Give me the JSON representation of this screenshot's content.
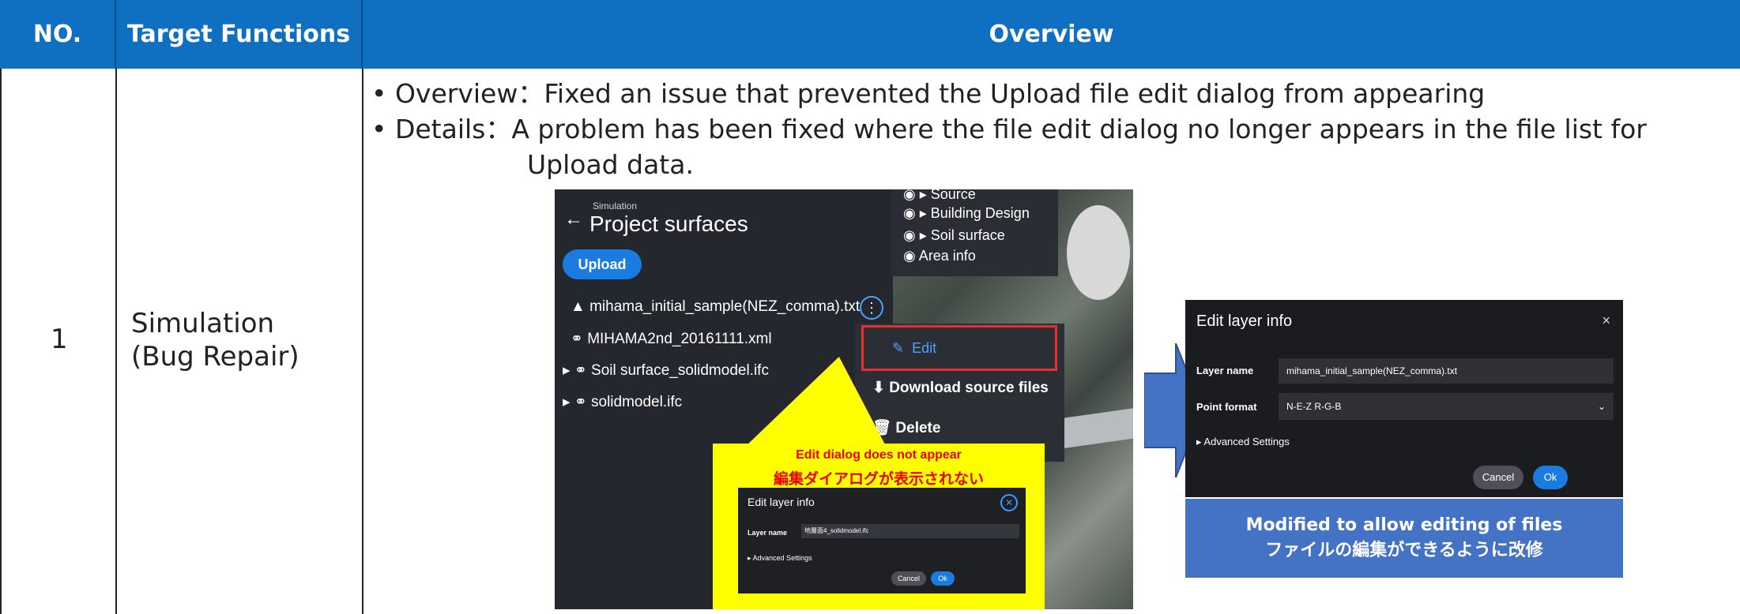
{
  "header": {
    "no": "NO.",
    "target": "Target Functions",
    "overview": "Overview"
  },
  "row": {
    "no": "1",
    "target_line1": "Simulation",
    "target_line2": "(Bug Repair)",
    "overview_line": "• Overview：Fixed an issue that prevented the Upload file edit dialog from appearing",
    "details_line1": "• Details：A problem has been fixed where the file edit dialog no longer appears in the file list for",
    "details_line2": "Upload data."
  },
  "before_screen": {
    "breadcrumb": "Simulation",
    "title": "Project surfaces",
    "upload_button": "Upload",
    "layers": [
      "Source",
      "Building Design",
      "Soil surface",
      "Area info"
    ],
    "files": [
      "mihama_initial_sample(NEZ_comma).txt",
      "MIHAMA2nd_20161111.xml",
      "Soil surface_solidmodel.ifc",
      "solidmodel.ifc"
    ],
    "menu": {
      "edit": "Edit",
      "download": "Download source files",
      "delete": "Delete"
    },
    "callout_en": "Edit dialog does not appear",
    "callout_ja": "編集ダイアログが表示されない",
    "mini_dialog": {
      "title": "Edit layer info",
      "layer_name_label": "Layer name",
      "layer_name_value": "地層面4_solidmodel.ifc",
      "advanced": "Advanced Settings",
      "cancel": "Cancel",
      "ok": "Ok"
    }
  },
  "after_dialog": {
    "title": "Edit layer info",
    "close": "×",
    "layer_name_label": "Layer name",
    "layer_name_value": "mihama_initial_sample(NEZ_comma).txt",
    "point_format_label": "Point format",
    "point_format_value": "N-E-Z R-G-B",
    "advanced": "Advanced Settings",
    "cancel": "Cancel",
    "ok": "Ok"
  },
  "note": {
    "en": "Modified to allow editing of files",
    "ja": "ファイルの編集ができるように改修"
  },
  "colors": {
    "header": "#0f6fc0",
    "note": "#4472c4",
    "callout": "#ffff00",
    "highlight": "#e53030"
  }
}
